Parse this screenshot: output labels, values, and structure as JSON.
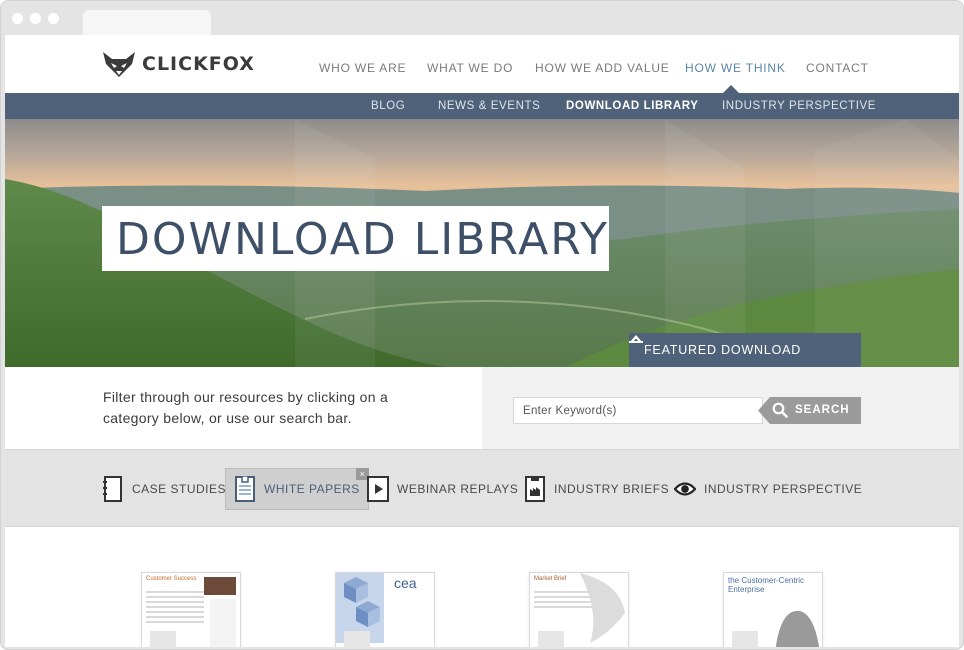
{
  "brand": {
    "name": "CLICKFOX"
  },
  "main_nav": [
    {
      "label": "WHO WE ARE",
      "active": false
    },
    {
      "label": "WHAT WE DO",
      "active": false
    },
    {
      "label": "HOW WE ADD VALUE",
      "active": false
    },
    {
      "label": "HOW WE THINK",
      "active": true
    },
    {
      "label": "CONTACT",
      "active": false
    }
  ],
  "sub_nav": [
    {
      "label": "BLOG",
      "active": false
    },
    {
      "label": "NEWS & EVENTS",
      "active": false
    },
    {
      "label": "DOWNLOAD LIBRARY",
      "active": true
    },
    {
      "label": "INDUSTRY PERSPECTIVE",
      "active": false
    }
  ],
  "hero": {
    "title": "DOWNLOAD LIBRARY",
    "featured_label": "FEATURED DOWNLOAD",
    "featured_icon": "chevron-up-icon"
  },
  "filter": {
    "intro": "Filter through our resources by clicking on a category below, or use our search bar.",
    "search_placeholder": "Enter Keyword(s)",
    "search_button": "SEARCH",
    "search_icon": "search-icon"
  },
  "categories": [
    {
      "label": "CASE STUDIES",
      "icon": "case-study-icon",
      "selected": false
    },
    {
      "label": "WHITE PAPERS",
      "icon": "white-paper-icon",
      "selected": true,
      "close": "×"
    },
    {
      "label": "WEBINAR REPLAYS",
      "icon": "play-icon",
      "selected": false
    },
    {
      "label": "INDUSTRY BRIEFS",
      "icon": "industry-brief-icon",
      "selected": false
    },
    {
      "label": "INDUSTRY PERSPECTIVE",
      "icon": "eye-icon",
      "selected": false
    }
  ],
  "thumbnails": [
    {
      "title": "Customer Success",
      "logo": ""
    },
    {
      "title": "",
      "logo": "cea"
    },
    {
      "title": "Market Brief",
      "logo": ""
    },
    {
      "title": "the Customer-Centric Enterprise",
      "logo": ""
    }
  ],
  "colors": {
    "nav_active": "#5b86aa",
    "subnav_bg": "#4f6279",
    "title_text": "#3e5068"
  }
}
